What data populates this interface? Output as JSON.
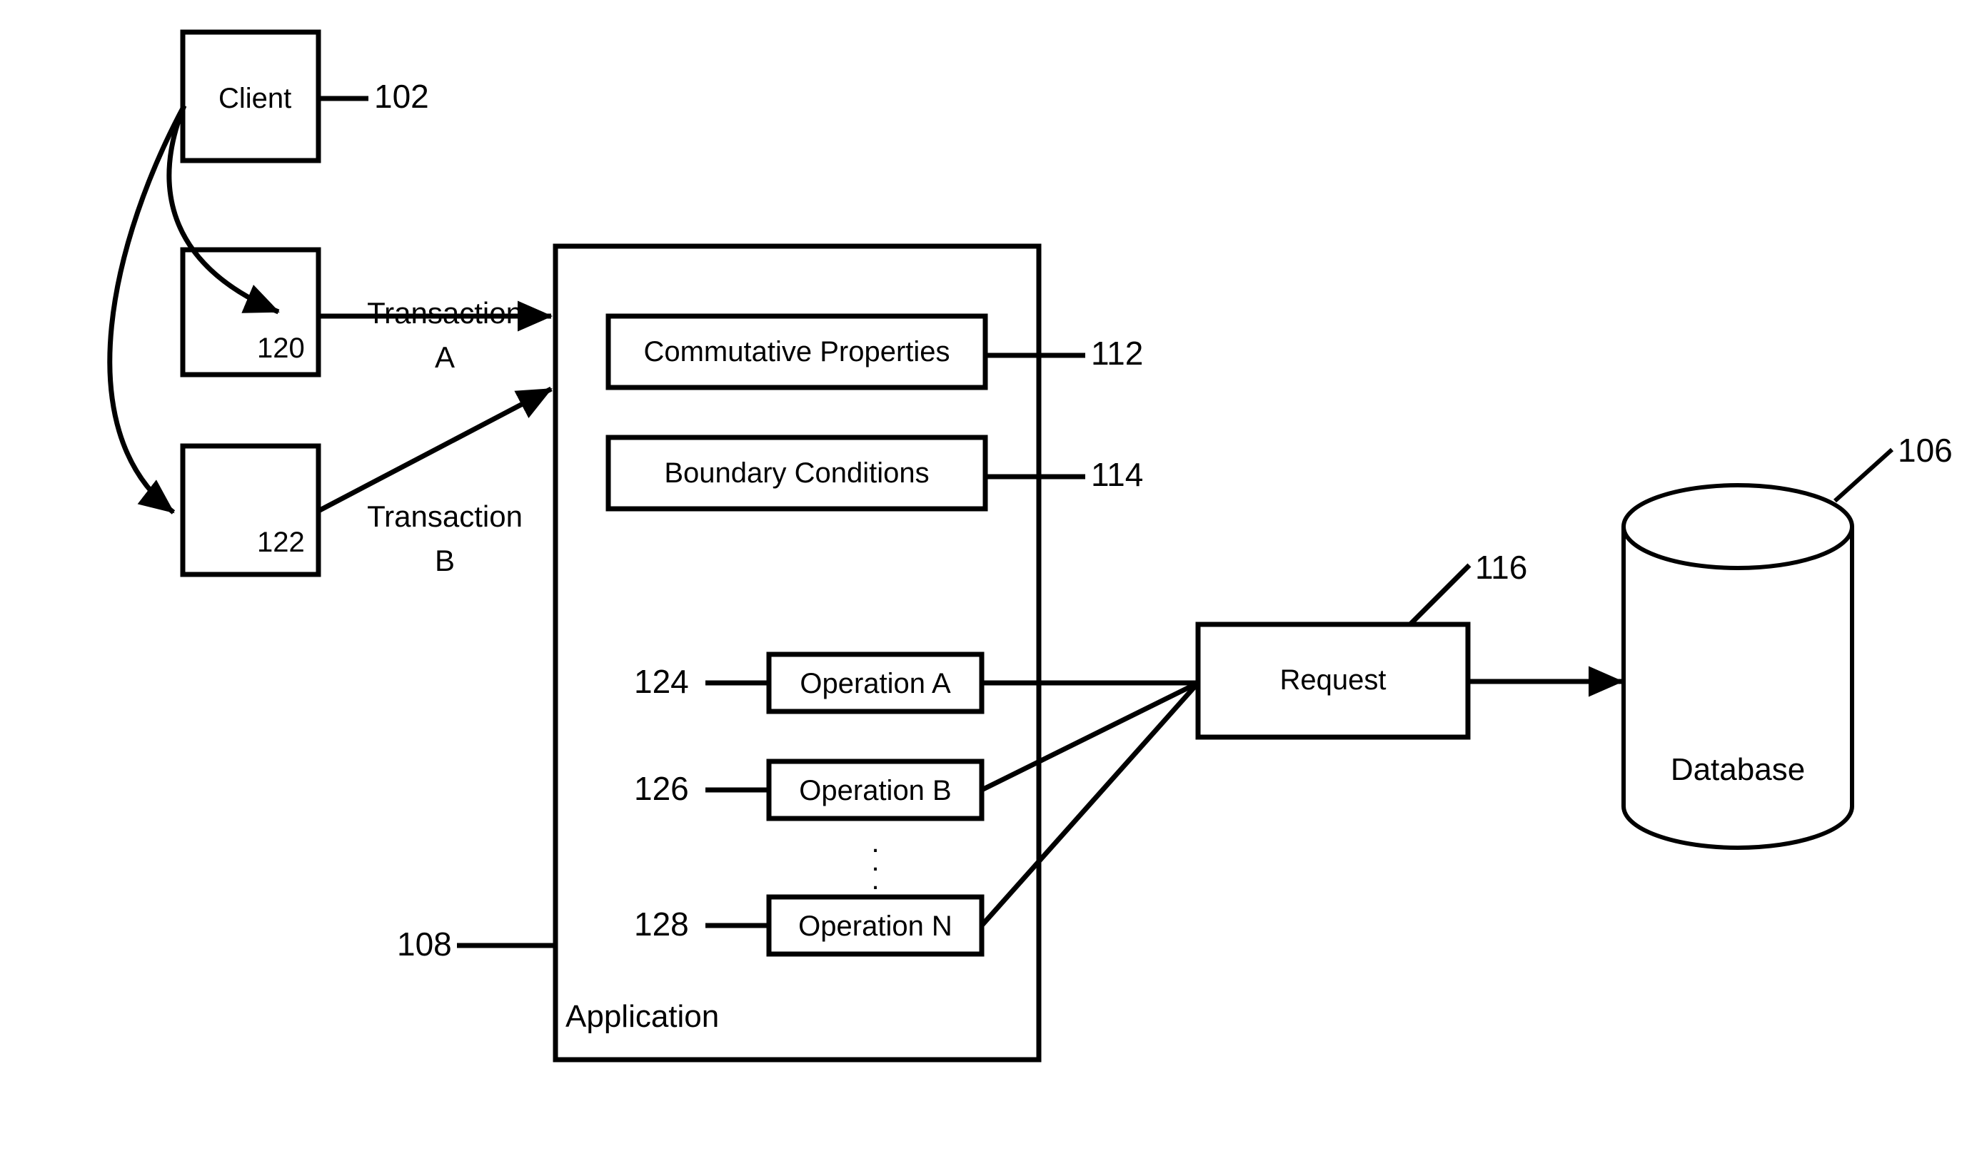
{
  "figure": {
    "type": "patent-block-diagram",
    "background_color": "#ffffff",
    "line_color": "#000000"
  },
  "nodes": {
    "client": {
      "label": "Client",
      "ref": "102"
    },
    "transaction_box_a": {
      "ref_inside": "120"
    },
    "transaction_box_b": {
      "ref_inside": "122"
    },
    "application": {
      "label": "Application",
      "ref": "108"
    },
    "commutative_properties": {
      "label": "Commutative Properties",
      "ref": "112"
    },
    "boundary_conditions": {
      "label": "Boundary Conditions",
      "ref": "114"
    },
    "operation_a": {
      "label": "Operation A",
      "ref": "124"
    },
    "operation_b": {
      "label": "Operation B",
      "ref": "126"
    },
    "operation_n": {
      "label": "Operation N",
      "ref": "128"
    },
    "operations_ellipsis": "⋮",
    "request": {
      "label": "Request",
      "ref": "116"
    },
    "database": {
      "label": "Database",
      "ref": "106"
    }
  },
  "edges": {
    "transaction_a": {
      "line1": "Transaction",
      "line2": "A"
    },
    "transaction_b": {
      "line1": "Transaction",
      "line2": "B"
    }
  }
}
